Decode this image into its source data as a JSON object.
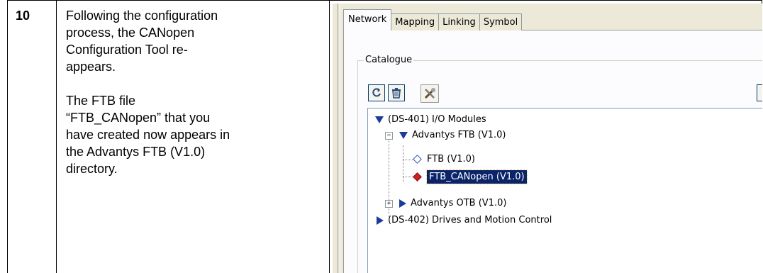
{
  "step": {
    "number": "10",
    "paragraphs": [
      "Following the configuration\nprocess, the CANopen\nConfiguration Tool re-\nappears.",
      "The FTB file\n“FTB_CANopen” that you\nhave created now appears in\nthe Advantys FTB (V1.0)\ndirectory."
    ]
  },
  "window": {
    "tabs": [
      "Network",
      "Mapping",
      "Linking",
      "Symbol"
    ],
    "active_tab": "Network",
    "group_label": "Catalogue",
    "toolbar": [
      {
        "icon": "refresh-icon"
      },
      {
        "icon": "trash-icon"
      },
      {
        "icon": "tools-icon"
      }
    ],
    "tree": [
      {
        "label": "(DS-401) I/O Modules",
        "icon": "triangle-down-icon"
      },
      {
        "label": "Advantys FTB (V1.0)",
        "icon": "triangle-down-icon",
        "expander": "−"
      },
      {
        "label": "FTB (V1.0)",
        "icon": "diamond-outline-icon"
      },
      {
        "label": "FTB_CANopen (V1.0)",
        "icon": "diamond-red-icon",
        "selected": true
      },
      {
        "label": "Advantys OTB (V1.0)",
        "icon": "triangle-right-icon",
        "expander": "+"
      },
      {
        "label": "(DS-402) Drives and Motion Control",
        "icon": "triangle-right-icon"
      }
    ]
  }
}
